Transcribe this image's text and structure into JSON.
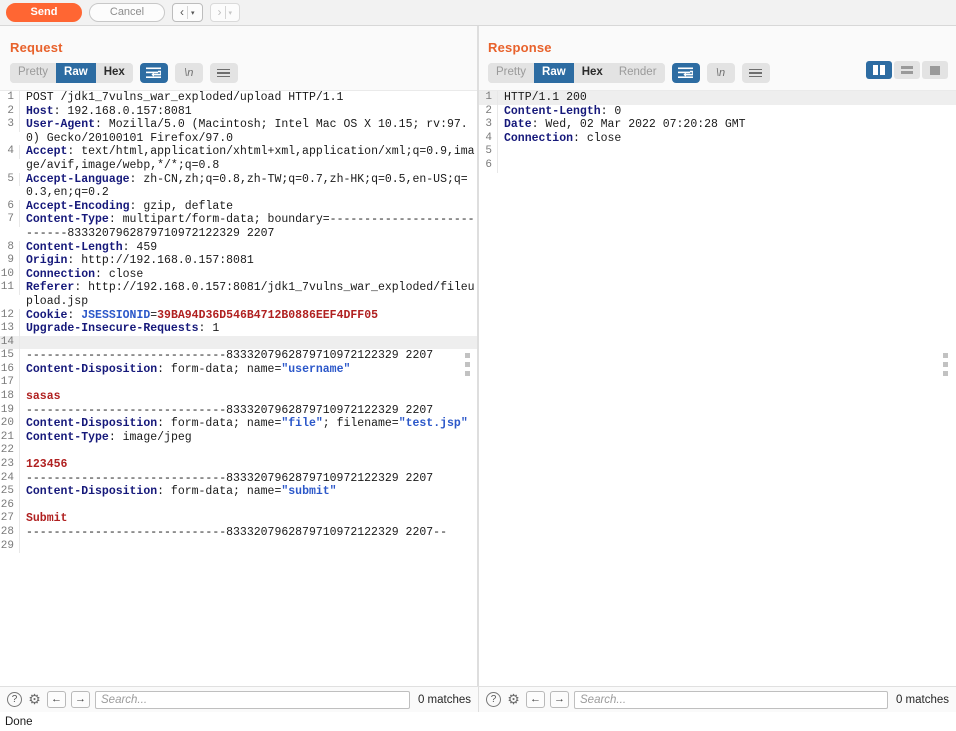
{
  "toolbar": {
    "send_label": "Send",
    "cancel_label": "Cancel",
    "back_glyph": "‹",
    "forward_glyph": "›",
    "caret_glyph": "▾"
  },
  "colors": {
    "accent_orange": "#ff6633",
    "title_orange": "#e8622c",
    "active_blue": "#2d6ca2",
    "header_navy": "#15187a",
    "value_blue": "#2b57c9",
    "value_red": "#b02020"
  },
  "request": {
    "title": "Request",
    "tabs": [
      "Pretty",
      "Raw",
      "Hex"
    ],
    "active_tab": "Raw",
    "icons": {
      "wrap": "word-wrap-icon",
      "newline": "\\n",
      "menu": "hamburger-icon"
    },
    "lines": [
      {
        "n": "1",
        "parts": [
          {
            "t": "POST /jdk1_7vulns_war_exploded/upload HTTP/1.1",
            "c": "plain"
          }
        ]
      },
      {
        "n": "2",
        "parts": [
          {
            "t": "Host",
            "c": "hdr"
          },
          {
            "t": ": 192.168.0.157:8081",
            "c": "plain"
          }
        ]
      },
      {
        "n": "3",
        "parts": [
          {
            "t": "User-Agent",
            "c": "hdr"
          },
          {
            "t": ": Mozilla/5.0 (Macintosh; Intel Mac OS X 10.15; rv:97.0) Gecko/20100101 Firefox/97.0",
            "c": "plain"
          }
        ]
      },
      {
        "n": "4",
        "parts": [
          {
            "t": "Accept",
            "c": "hdr"
          },
          {
            "t": ": text/html,application/xhtml+xml,application/xml;q=0.9,image/avif,image/webp,*/*;q=0.8",
            "c": "plain"
          }
        ]
      },
      {
        "n": "5",
        "parts": [
          {
            "t": "Accept-Language",
            "c": "hdr"
          },
          {
            "t": ": zh-CN,zh;q=0.8,zh-TW;q=0.7,zh-HK;q=0.5,en-US;q=0.3,en;q=0.2",
            "c": "plain"
          }
        ]
      },
      {
        "n": "6",
        "parts": [
          {
            "t": "Accept-Encoding",
            "c": "hdr"
          },
          {
            "t": ": gzip, deflate",
            "c": "plain"
          }
        ]
      },
      {
        "n": "7",
        "parts": [
          {
            "t": "Content-Type",
            "c": "hdr"
          },
          {
            "t": ": multipart/form-data; boundary=---------------------------8333207962879710972122329 2207",
            "c": "plain"
          }
        ]
      },
      {
        "n": "8",
        "parts": [
          {
            "t": "Content-Length",
            "c": "hdr"
          },
          {
            "t": ": 459",
            "c": "plain"
          }
        ]
      },
      {
        "n": "9",
        "parts": [
          {
            "t": "Origin",
            "c": "hdr"
          },
          {
            "t": ": http://192.168.0.157:8081",
            "c": "plain"
          }
        ]
      },
      {
        "n": "10",
        "parts": [
          {
            "t": "Connection",
            "c": "hdr"
          },
          {
            "t": ": close",
            "c": "plain"
          }
        ]
      },
      {
        "n": "11",
        "parts": [
          {
            "t": "Referer",
            "c": "hdr"
          },
          {
            "t": ": http://192.168.0.157:8081/jdk1_7vulns_war_exploded/fileupload.jsp",
            "c": "plain"
          }
        ]
      },
      {
        "n": "12",
        "parts": [
          {
            "t": "Cookie",
            "c": "hdr"
          },
          {
            "t": ": ",
            "c": "plain"
          },
          {
            "t": "JSESSIONID",
            "c": "blue"
          },
          {
            "t": "=",
            "c": "plain"
          },
          {
            "t": "39BA94D36D546B4712B0886EEF4DFF05",
            "c": "red"
          }
        ]
      },
      {
        "n": "13",
        "parts": [
          {
            "t": "Upgrade-Insecure-Requests",
            "c": "hdr"
          },
          {
            "t": ": 1",
            "c": "plain"
          }
        ]
      },
      {
        "n": "14",
        "parts": [
          {
            "t": "",
            "c": "plain"
          }
        ],
        "highlight": true
      },
      {
        "n": "15",
        "parts": [
          {
            "t": "-----------------------------8333207962879710972122329 2207",
            "c": "plain"
          }
        ]
      },
      {
        "n": "16",
        "parts": [
          {
            "t": "Content-Disposition",
            "c": "hdr"
          },
          {
            "t": ": form-data; name=",
            "c": "plain"
          },
          {
            "t": "\"username\"",
            "c": "blue"
          }
        ]
      },
      {
        "n": "17",
        "parts": [
          {
            "t": "",
            "c": "plain"
          }
        ]
      },
      {
        "n": "18",
        "parts": [
          {
            "t": "sasas",
            "c": "red"
          }
        ]
      },
      {
        "n": "19",
        "parts": [
          {
            "t": "-----------------------------8333207962879710972122329 2207",
            "c": "plain"
          }
        ]
      },
      {
        "n": "20",
        "parts": [
          {
            "t": "Content-Disposition",
            "c": "hdr"
          },
          {
            "t": ": form-data; name=",
            "c": "plain"
          },
          {
            "t": "\"file\"",
            "c": "blue"
          },
          {
            "t": "; filename=",
            "c": "plain"
          },
          {
            "t": "\"test.jsp\"",
            "c": "blue"
          }
        ]
      },
      {
        "n": "21",
        "parts": [
          {
            "t": "Content-Type",
            "c": "hdr"
          },
          {
            "t": ": image/jpeg",
            "c": "plain"
          }
        ]
      },
      {
        "n": "22",
        "parts": [
          {
            "t": "",
            "c": "plain"
          }
        ]
      },
      {
        "n": "23",
        "parts": [
          {
            "t": "123456",
            "c": "red"
          }
        ]
      },
      {
        "n": "24",
        "parts": [
          {
            "t": "-----------------------------8333207962879710972122329 2207",
            "c": "plain"
          }
        ]
      },
      {
        "n": "25",
        "parts": [
          {
            "t": "Content-Disposition",
            "c": "hdr"
          },
          {
            "t": ": form-data; name=",
            "c": "plain"
          },
          {
            "t": "\"submit\"",
            "c": "blue"
          }
        ]
      },
      {
        "n": "26",
        "parts": [
          {
            "t": "",
            "c": "plain"
          }
        ]
      },
      {
        "n": "27",
        "parts": [
          {
            "t": "Submit",
            "c": "red"
          }
        ]
      },
      {
        "n": "28",
        "parts": [
          {
            "t": "-----------------------------8333207962879710972122329 2207--",
            "c": "plain"
          }
        ]
      },
      {
        "n": "29",
        "parts": [
          {
            "t": "",
            "c": "plain"
          }
        ]
      }
    ],
    "footer": {
      "help_glyph": "?",
      "gear_glyph": "⚙",
      "prev_glyph": "←",
      "next_glyph": "→",
      "search_value": "",
      "search_placeholder": "Search...",
      "matches": "0 matches"
    }
  },
  "response": {
    "title": "Response",
    "tabs": [
      "Pretty",
      "Raw",
      "Hex",
      "Render"
    ],
    "active_tab": "Raw",
    "icons": {
      "wrap": "word-wrap-icon",
      "newline": "\\n",
      "menu": "hamburger-icon"
    },
    "view_modes": [
      "split-view",
      "rows-view",
      "single-view"
    ],
    "active_view_mode": "split-view",
    "lines": [
      {
        "n": "1",
        "parts": [
          {
            "t": "HTTP/1.1 200",
            "c": "plain"
          }
        ],
        "highlight": true
      },
      {
        "n": "2",
        "parts": [
          {
            "t": "Content-Length",
            "c": "hdr"
          },
          {
            "t": ": 0",
            "c": "plain"
          }
        ]
      },
      {
        "n": "3",
        "parts": [
          {
            "t": "Date",
            "c": "hdr"
          },
          {
            "t": ": Wed, 02 Mar 2022 07:20:28 GMT",
            "c": "plain"
          }
        ]
      },
      {
        "n": "4",
        "parts": [
          {
            "t": "Connection",
            "c": "hdr"
          },
          {
            "t": ": close",
            "c": "plain"
          }
        ]
      },
      {
        "n": "5",
        "parts": [
          {
            "t": "",
            "c": "plain"
          }
        ]
      },
      {
        "n": "6",
        "parts": [
          {
            "t": "",
            "c": "plain"
          }
        ]
      }
    ],
    "footer": {
      "help_glyph": "?",
      "gear_glyph": "⚙",
      "prev_glyph": "←",
      "next_glyph": "→",
      "search_value": "",
      "search_placeholder": "Search...",
      "matches": "0 matches"
    }
  },
  "status_bar": {
    "text": "Done"
  }
}
